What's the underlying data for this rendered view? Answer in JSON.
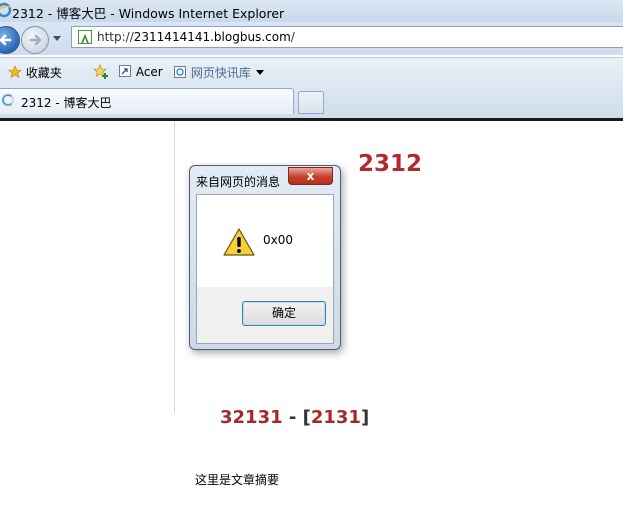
{
  "window": {
    "title": "2312 - 博客大巴 - Windows Internet Explorer"
  },
  "address": {
    "scheme": "http://",
    "host": "2311414141.blogbus.com",
    "path": "/"
  },
  "favorites": {
    "label": "收藏夹",
    "items": [
      {
        "label": "Acer"
      },
      {
        "label": "网页快讯库"
      }
    ]
  },
  "tabs": [
    {
      "label": "2312 - 博客大巴"
    }
  ],
  "page": {
    "blog_title": "2312",
    "post": {
      "title_a": "32131",
      "separator": " - [",
      "title_b": "2131",
      "close": "]"
    },
    "summary": "这里是文章摘要"
  },
  "dialog": {
    "title": "来自网页的消息",
    "close_label": "x",
    "message": "0x00",
    "ok_label": "确定"
  }
}
